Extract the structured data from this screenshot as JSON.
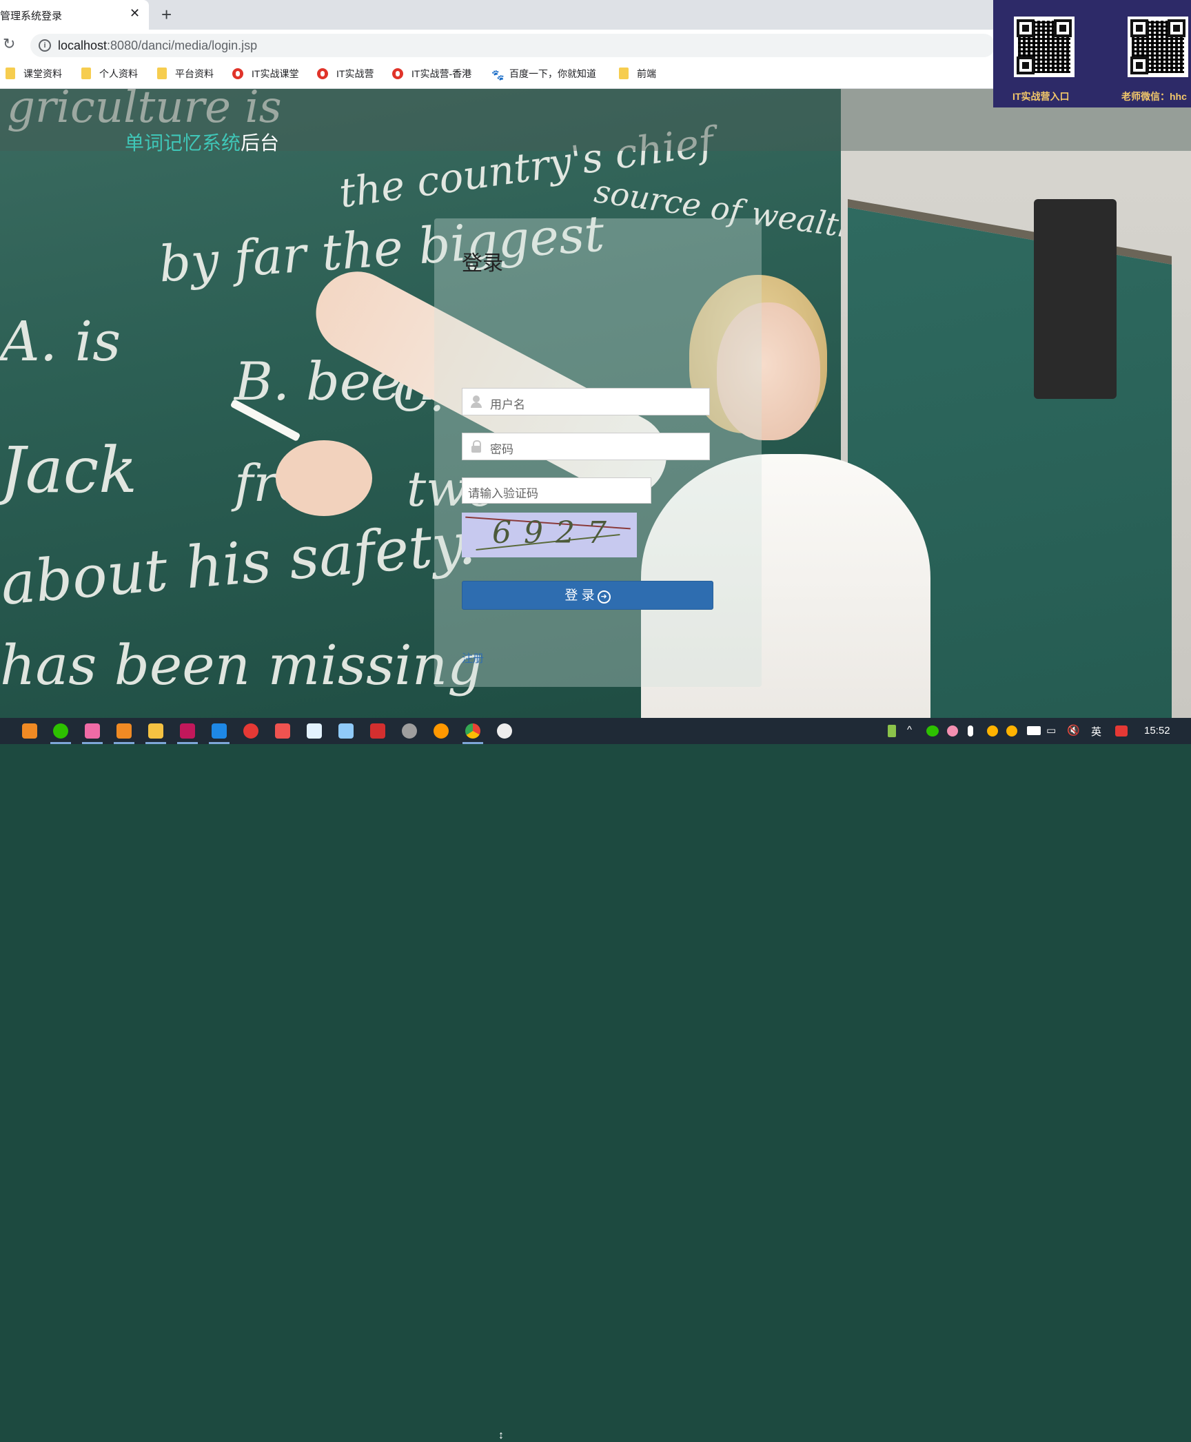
{
  "browser": {
    "tab_title": "管理系统登录",
    "close_glyph": "✕",
    "new_tab_glyph": "+",
    "reload_glyph": "↻",
    "url_host": "localhost",
    "url_rest": ":8080/danci/media/login.jsp",
    "bookmarks": [
      {
        "label": "课堂资料",
        "icon": "folder-icon"
      },
      {
        "label": "个人资料",
        "icon": "folder-icon"
      },
      {
        "label": "平台资料",
        "icon": "folder-icon"
      },
      {
        "label": "IT实战课堂",
        "icon": "site-icon"
      },
      {
        "label": "IT实战营",
        "icon": "site-icon"
      },
      {
        "label": "IT实战营-香港",
        "icon": "site-icon"
      },
      {
        "label": "百度一下，你就知道",
        "icon": "baidu-icon"
      },
      {
        "label": "前端",
        "icon": "folder-icon"
      }
    ]
  },
  "header": {
    "brand_part1": "单词记忆系统",
    "brand_part2": "后台"
  },
  "login": {
    "title": "登录",
    "username_placeholder": "用户名",
    "password_placeholder": "密码",
    "captcha_placeholder": "请输入验证码",
    "captcha_code": "6927",
    "submit_label": "登 录",
    "register_label": "注册"
  },
  "qr_overlay": {
    "left_label": "IT实战营入口",
    "right_label": "老师微信：hhc"
  },
  "taskbar": {
    "time": "15:52",
    "ime": "英"
  },
  "chalk_text": [
    "griculture is",
    "the country's chief",
    "source of wealth, where",
    "by far the biggest",
    "A. is",
    "B. been",
    "C. be",
    "Jack",
    "from",
    "two",
    "about his safety.",
    "has been missing"
  ],
  "colors": {
    "brand_accent": "#3fc7b8",
    "login_button": "#2e6db0",
    "qr_panel": "#2d2a68",
    "qr_label": "#f3c86a"
  }
}
